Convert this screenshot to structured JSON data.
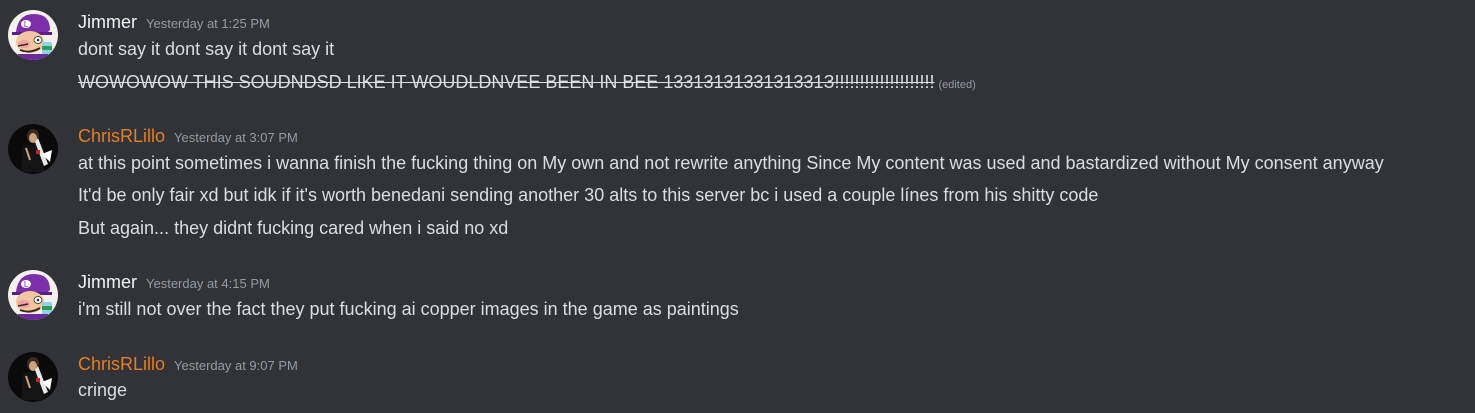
{
  "messages": [
    {
      "username": "Jimmer",
      "timestamp": "Yesterday at 1:25 PM",
      "avatar_icon": "jimmer-avatar-icon",
      "lines": [
        {
          "text": "dont say it dont say it dont say it"
        },
        {
          "text": "WOWOWOW THIS SOUDNDSD LIKE IT WOUDLDNVEE BEEN IN BEE 1331313133131331З!!!!!!!!!!!!!!!!!!!!",
          "strikethrough": true,
          "edited": "(edited)"
        }
      ]
    },
    {
      "username": "ChrisRLillo",
      "timestamp": "Yesterday at 3:07 PM",
      "avatar_icon": "chrisrlillo-avatar-icon",
      "username_color": "#e67e22",
      "lines": [
        {
          "text": "at this point sometimes i wanna finish the fucking thing on My own and not rewrite anything Since My content was used and bastardized without My consent anyway"
        },
        {
          "text": "It'd be only fair xd but idk if it's worth benedani sending another 30 alts to this server bc i used a couple línes from his shitty code"
        },
        {
          "text": "But again... they didnt fucking cared when i said no xd"
        }
      ]
    },
    {
      "username": "Jimmer",
      "timestamp": "Yesterday at 4:15 PM",
      "avatar_icon": "jimmer-avatar-icon",
      "lines": [
        {
          "text": "i'm still not over the fact they put fucking ai copper images in the game as paintings"
        }
      ]
    },
    {
      "username": "ChrisRLillo",
      "timestamp": "Yesterday at 9:07 PM",
      "avatar_icon": "chrisrlillo-avatar-icon",
      "username_color": "#e67e22",
      "lines": [
        {
          "text": "cringe"
        }
      ]
    }
  ],
  "colors": {
    "background": "#313338",
    "username_default": "#f2f3f5",
    "username_orange": "#e67e22",
    "message_text": "#dbdee1",
    "timestamp": "#949ba4"
  }
}
